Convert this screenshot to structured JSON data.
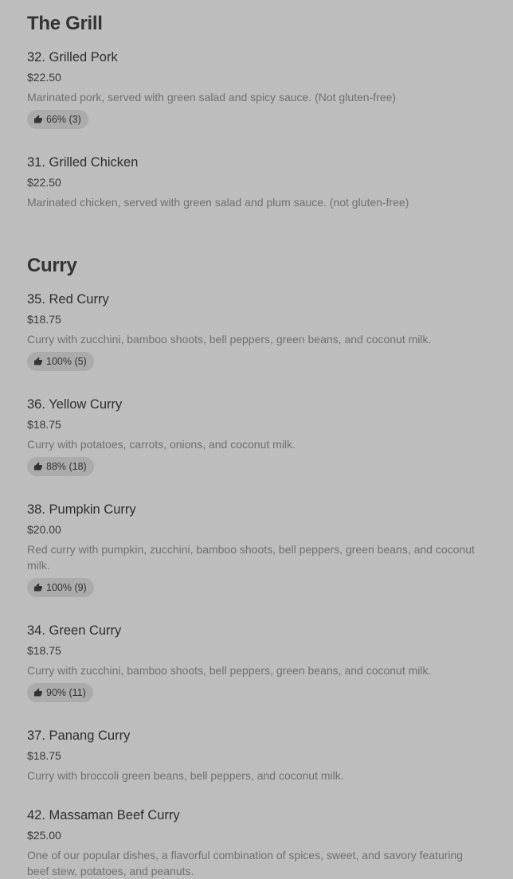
{
  "sections": [
    {
      "title": "The Grill",
      "items": [
        {
          "name": "32. Grilled Pork",
          "price": "$22.50",
          "description": "Marinated pork, served with green salad and spicy sauce. (Not gluten-free)",
          "rating": "66% (3)"
        },
        {
          "name": "31. Grilled Chicken",
          "price": "$22.50",
          "description": "Marinated chicken, served with green salad and plum sauce. (not gluten-free)",
          "rating": ""
        }
      ]
    },
    {
      "title": "Curry",
      "items": [
        {
          "name": "35. Red Curry",
          "price": "$18.75",
          "description": "Curry with zucchini, bamboo shoots, bell peppers, green beans, and coconut milk.",
          "rating": "100% (5)"
        },
        {
          "name": "36. Yellow Curry",
          "price": "$18.75",
          "description": "Curry with potatoes, carrots, onions, and coconut milk.",
          "rating": "88% (18)"
        },
        {
          "name": "38. Pumpkin Curry",
          "price": "$20.00",
          "description": "Red curry with pumpkin, zucchini, bamboo shoots, bell peppers, green beans, and coconut milk.",
          "rating": "100% (9)"
        },
        {
          "name": "34. Green Curry",
          "price": "$18.75",
          "description": "Curry with zucchini, bamboo shoots, bell peppers, green beans, and coconut milk.",
          "rating": "90% (11)"
        },
        {
          "name": "37. Panang Curry",
          "price": "$18.75",
          "description": "Curry with broccoli green beans, bell peppers, and coconut milk.",
          "rating": ""
        },
        {
          "name": "42. Massaman Beef Curry",
          "price": "$25.00",
          "description": "One of our popular dishes, a flavorful combination of spices, sweet, and savory featuring beef stew, potatoes, and peanuts.",
          "rating": ""
        }
      ]
    }
  ],
  "icons": {
    "rating": "thumbs-up-icon"
  }
}
